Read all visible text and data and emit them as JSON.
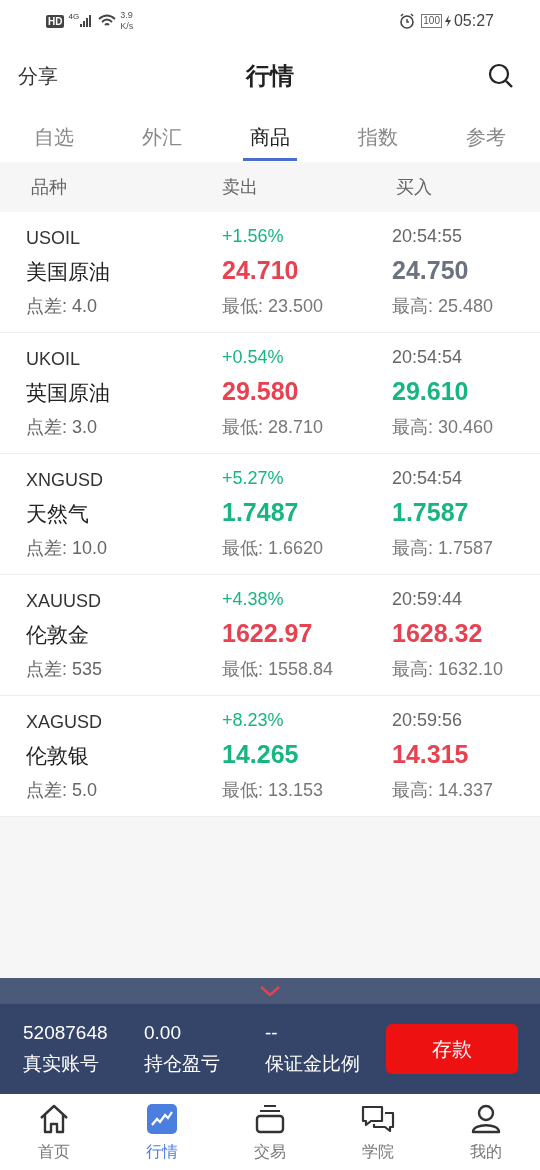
{
  "status_bar": {
    "hd": "HD",
    "network": "4G",
    "speed_value": "3.9",
    "speed_unit": "K/s",
    "battery": "100",
    "time": "05:27"
  },
  "header": {
    "left": "分享",
    "title": "行情"
  },
  "tabs": [
    {
      "label": "自选",
      "selected": false
    },
    {
      "label": "外汇",
      "selected": false
    },
    {
      "label": "商品",
      "selected": true
    },
    {
      "label": "指数",
      "selected": false
    },
    {
      "label": "参考",
      "selected": false
    }
  ],
  "columns": [
    "品种",
    "卖出",
    "买入"
  ],
  "rows": [
    {
      "symbol": "USOIL",
      "name": "美国原油",
      "spread": "点差: 4.0",
      "change": "+1.56%",
      "sell": {
        "price": "24.710",
        "color": "#e8414f"
      },
      "low": "最低: 23.500",
      "time": "20:54:55",
      "buy": {
        "price": "24.750",
        "color": "#6b7280"
      },
      "high": "最高: 25.480"
    },
    {
      "symbol": "UKOIL",
      "name": "英国原油",
      "spread": "点差: 3.0",
      "change": "+0.54%",
      "sell": {
        "price": "29.580",
        "color": "#e8414f"
      },
      "low": "最低: 28.710",
      "time": "20:54:54",
      "buy": {
        "price": "29.610",
        "color": "#16b67e"
      },
      "high": "最高: 30.460"
    },
    {
      "symbol": "XNGUSD",
      "name": "天然气",
      "spread": "点差: 10.0",
      "change": "+5.27%",
      "sell": {
        "price": "1.7487",
        "color": "#16b67e"
      },
      "low": "最低: 1.6620",
      "time": "20:54:54",
      "buy": {
        "price": "1.7587",
        "color": "#16b67e"
      },
      "high": "最高: 1.7587"
    },
    {
      "symbol": "XAUUSD",
      "name": "伦敦金",
      "spread": "点差: 535",
      "change": "+4.38%",
      "sell": {
        "price": "1622.97",
        "color": "#e8414f"
      },
      "low": "最低: 1558.84",
      "time": "20:59:44",
      "buy": {
        "price": "1628.32",
        "color": "#e8414f"
      },
      "high": "最高: 1632.10"
    },
    {
      "symbol": "XAGUSD",
      "name": "伦敦银",
      "spread": "点差: 5.0",
      "change": "+8.23%",
      "sell": {
        "price": "14.265",
        "color": "#16b67e"
      },
      "low": "最低: 13.153",
      "time": "20:59:56",
      "buy": {
        "price": "14.315",
        "color": "#e8414f"
      },
      "high": "最高: 14.337"
    }
  ],
  "account": {
    "items": [
      {
        "value": "52087648",
        "label": "真实账号"
      },
      {
        "value": "0.00",
        "label": "持仓盈亏"
      },
      {
        "value": "--",
        "label": "保证金比例"
      }
    ],
    "button": "存款"
  },
  "nav": [
    {
      "label": "首页",
      "kind": "home",
      "selected": false
    },
    {
      "label": "行情",
      "kind": "market",
      "selected": true
    },
    {
      "label": "交易",
      "kind": "trade",
      "selected": false
    },
    {
      "label": "学院",
      "kind": "academy",
      "selected": false
    },
    {
      "label": "我的",
      "kind": "profile",
      "selected": false
    }
  ]
}
